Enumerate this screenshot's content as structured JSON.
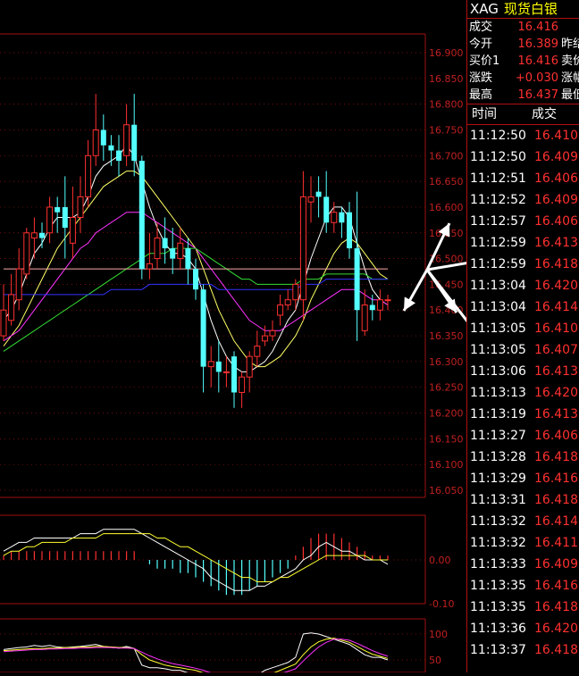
{
  "header": {
    "symbol": "XAG",
    "name": "现货白银"
  },
  "quote": [
    {
      "label": "成交",
      "value": "16.416",
      "label2": ""
    },
    {
      "label": "今开",
      "value": "16.389",
      "label2": "昨结"
    },
    {
      "label": "买价1",
      "value": "16.416",
      "label2": "卖价"
    },
    {
      "label": "涨跌",
      "value": "+0.030",
      "label2": "涨幅"
    },
    {
      "label": "最高",
      "value": "16.437",
      "label2": "最低"
    }
  ],
  "ticks_header": {
    "time": "时间",
    "price": "成交"
  },
  "ticks": [
    {
      "time": "11:12:50",
      "price": "16.410"
    },
    {
      "time": "11:12:50",
      "price": "16.409"
    },
    {
      "time": "11:12:51",
      "price": "16.406"
    },
    {
      "time": "11:12:52",
      "price": "16.409"
    },
    {
      "time": "11:12:57",
      "price": "16.406"
    },
    {
      "time": "11:12:59",
      "price": "16.413"
    },
    {
      "time": "11:12:59",
      "price": "16.418"
    },
    {
      "time": "11:13:04",
      "price": "16.420"
    },
    {
      "time": "11:13:04",
      "price": "16.414"
    },
    {
      "time": "11:13:05",
      "price": "16.410"
    },
    {
      "time": "11:13:05",
      "price": "16.407"
    },
    {
      "time": "11:13:06",
      "price": "16.413"
    },
    {
      "time": "11:13:13",
      "price": "16.420"
    },
    {
      "time": "11:13:19",
      "price": "16.413"
    },
    {
      "time": "11:13:27",
      "price": "16.406"
    },
    {
      "time": "11:13:28",
      "price": "16.418"
    },
    {
      "time": "11:13:29",
      "price": "16.416"
    },
    {
      "time": "11:13:31",
      "price": "16.418"
    },
    {
      "time": "11:13:32",
      "price": "16.414"
    },
    {
      "time": "11:13:32",
      "price": "16.411"
    },
    {
      "time": "11:13:33",
      "price": "16.409"
    },
    {
      "time": "11:13:35",
      "price": "16.416"
    },
    {
      "time": "11:13:35",
      "price": "16.418"
    },
    {
      "time": "11:13:36",
      "price": "16.420"
    },
    {
      "time": "11:13:37",
      "price": "16.418"
    }
  ],
  "colors": {
    "up": "#ff3030",
    "down": "#54ffff",
    "grid": "#a01010",
    "label": "#c02020"
  },
  "chart_data": [
    {
      "type": "candlestick",
      "y_ticks": [
        "16.900",
        "16.850",
        "16.800",
        "16.750",
        "16.700",
        "16.650",
        "16.600",
        "16.550",
        "16.500",
        "16.450",
        "16.400",
        "16.350",
        "16.300",
        "16.250",
        "16.200",
        "16.150",
        "16.100",
        "16.050"
      ],
      "ylim": [
        16.05,
        16.92
      ],
      "candles": [
        {
          "o": 16.35,
          "c": 16.4,
          "h": 16.45,
          "l": 16.34
        },
        {
          "o": 16.38,
          "c": 16.43,
          "h": 16.47,
          "l": 16.37
        },
        {
          "o": 16.42,
          "c": 16.48,
          "h": 16.52,
          "l": 16.4
        },
        {
          "o": 16.47,
          "c": 16.55,
          "h": 16.56,
          "l": 16.46
        },
        {
          "o": 16.54,
          "c": 16.55,
          "h": 16.58,
          "l": 16.5
        },
        {
          "o": 16.55,
          "c": 16.54,
          "h": 16.57,
          "l": 16.52
        },
        {
          "o": 16.55,
          "c": 16.6,
          "h": 16.62,
          "l": 16.53
        },
        {
          "o": 16.6,
          "c": 16.59,
          "h": 16.62,
          "l": 16.55
        },
        {
          "o": 16.6,
          "c": 16.56,
          "h": 16.66,
          "l": 16.5
        },
        {
          "o": 16.53,
          "c": 16.58,
          "h": 16.64,
          "l": 16.5
        },
        {
          "o": 16.58,
          "c": 16.62,
          "h": 16.66,
          "l": 16.55
        },
        {
          "o": 16.62,
          "c": 16.7,
          "h": 16.73,
          "l": 16.6
        },
        {
          "o": 16.7,
          "c": 16.75,
          "h": 16.82,
          "l": 16.68
        },
        {
          "o": 16.75,
          "c": 16.72,
          "h": 16.78,
          "l": 16.69
        },
        {
          "o": 16.72,
          "c": 16.71,
          "h": 16.74,
          "l": 16.68
        },
        {
          "o": 16.71,
          "c": 16.69,
          "h": 16.74,
          "l": 16.66
        },
        {
          "o": 16.7,
          "c": 16.76,
          "h": 16.8,
          "l": 16.68
        },
        {
          "o": 16.76,
          "c": 16.69,
          "h": 16.82,
          "l": 16.66
        },
        {
          "o": 16.69,
          "c": 16.48,
          "h": 16.7,
          "l": 16.46
        },
        {
          "o": 16.48,
          "c": 16.49,
          "h": 16.55,
          "l": 16.46
        },
        {
          "o": 16.5,
          "c": 16.54,
          "h": 16.57,
          "l": 16.48
        },
        {
          "o": 16.54,
          "c": 16.52,
          "h": 16.58,
          "l": 16.49
        },
        {
          "o": 16.52,
          "c": 16.5,
          "h": 16.56,
          "l": 16.47
        },
        {
          "o": 16.5,
          "c": 16.53,
          "h": 16.56,
          "l": 16.48
        },
        {
          "o": 16.52,
          "c": 16.48,
          "h": 16.54,
          "l": 16.45
        },
        {
          "o": 16.48,
          "c": 16.44,
          "h": 16.5,
          "l": 16.42
        },
        {
          "o": 16.44,
          "c": 16.29,
          "h": 16.45,
          "l": 16.24
        },
        {
          "o": 16.29,
          "c": 16.3,
          "h": 16.33,
          "l": 16.25
        },
        {
          "o": 16.3,
          "c": 16.28,
          "h": 16.34,
          "l": 16.24
        },
        {
          "o": 16.28,
          "c": 16.28,
          "h": 16.31,
          "l": 16.25
        },
        {
          "o": 16.31,
          "c": 16.24,
          "h": 16.32,
          "l": 16.21
        },
        {
          "o": 16.24,
          "c": 16.27,
          "h": 16.28,
          "l": 16.21
        },
        {
          "o": 16.27,
          "c": 16.31,
          "h": 16.32,
          "l": 16.24
        },
        {
          "o": 16.31,
          "c": 16.33,
          "h": 16.36,
          "l": 16.29
        },
        {
          "o": 16.34,
          "c": 16.35,
          "h": 16.37,
          "l": 16.33
        },
        {
          "o": 16.35,
          "c": 16.36,
          "h": 16.38,
          "l": 16.34
        },
        {
          "o": 16.39,
          "c": 16.41,
          "h": 16.43,
          "l": 16.37
        },
        {
          "o": 16.41,
          "c": 16.42,
          "h": 16.44,
          "l": 16.4
        },
        {
          "o": 16.42,
          "c": 16.45,
          "h": 16.46,
          "l": 16.4
        },
        {
          "o": 16.42,
          "c": 16.62,
          "h": 16.67,
          "l": 16.38
        },
        {
          "o": 16.61,
          "c": 16.62,
          "h": 16.66,
          "l": 16.57
        },
        {
          "o": 16.63,
          "c": 16.62,
          "h": 16.66,
          "l": 16.58
        },
        {
          "o": 16.62,
          "c": 16.57,
          "h": 16.67,
          "l": 16.55
        },
        {
          "o": 16.57,
          "c": 16.59,
          "h": 16.61,
          "l": 16.55
        },
        {
          "o": 16.59,
          "c": 16.57,
          "h": 16.6,
          "l": 16.54
        },
        {
          "o": 16.59,
          "c": 16.52,
          "h": 16.61,
          "l": 16.5
        },
        {
          "o": 16.52,
          "c": 16.4,
          "h": 16.63,
          "l": 16.34
        },
        {
          "o": 16.36,
          "c": 16.41,
          "h": 16.44,
          "l": 16.35
        },
        {
          "o": 16.41,
          "c": 16.4,
          "h": 16.43,
          "l": 16.38
        },
        {
          "o": 16.4,
          "c": 16.42,
          "h": 16.44,
          "l": 16.38
        },
        {
          "o": 16.42,
          "c": 16.42,
          "h": 16.43,
          "l": 16.4
        }
      ],
      "ma": [
        {
          "color": "#ffffff",
          "values": [
            16.38,
            16.4,
            16.43,
            16.47,
            16.51,
            16.53,
            16.56,
            16.58,
            16.58,
            16.58,
            16.59,
            16.62,
            16.66,
            16.68,
            16.69,
            16.7,
            16.72,
            16.7,
            16.65,
            16.6,
            16.56,
            16.53,
            16.51,
            16.51,
            16.5,
            16.48,
            16.43,
            16.38,
            16.34,
            16.31,
            16.29,
            16.28,
            16.28,
            16.29,
            16.3,
            16.32,
            16.35,
            16.38,
            16.4,
            16.45,
            16.5,
            16.54,
            16.58,
            16.6,
            16.6,
            16.58,
            16.53,
            16.48,
            16.44,
            16.42,
            16.41
          ]
        },
        {
          "color": "#ffff66",
          "values": [
            16.33,
            16.35,
            16.37,
            16.4,
            16.43,
            16.46,
            16.49,
            16.52,
            16.54,
            16.56,
            16.58,
            16.6,
            16.62,
            16.64,
            16.65,
            16.66,
            16.67,
            16.67,
            16.66,
            16.64,
            16.62,
            16.6,
            16.58,
            16.56,
            16.54,
            16.52,
            16.48,
            16.44,
            16.4,
            16.37,
            16.34,
            16.32,
            16.3,
            16.29,
            16.29,
            16.3,
            16.31,
            16.33,
            16.35,
            16.38,
            16.42,
            16.45,
            16.48,
            16.51,
            16.53,
            16.54,
            16.53,
            16.51,
            16.49,
            16.47,
            16.46
          ]
        },
        {
          "color": "#ff33ff",
          "values": [
            16.34,
            16.35,
            16.36,
            16.38,
            16.4,
            16.42,
            16.44,
            16.46,
            16.48,
            16.5,
            16.52,
            16.53,
            16.55,
            16.56,
            16.57,
            16.58,
            16.59,
            16.59,
            16.59,
            16.58,
            16.57,
            16.56,
            16.55,
            16.54,
            16.53,
            16.52,
            16.5,
            16.48,
            16.46,
            16.44,
            16.42,
            16.4,
            16.38,
            16.37,
            16.36,
            16.36,
            16.36,
            16.37,
            16.38,
            16.39,
            16.4,
            16.41,
            16.42,
            16.43,
            16.44,
            16.44,
            16.44,
            16.43,
            16.42,
            16.42,
            16.41
          ]
        },
        {
          "color": "#33dd33",
          "values": [
            16.32,
            16.33,
            16.34,
            16.35,
            16.36,
            16.37,
            16.38,
            16.39,
            16.4,
            16.41,
            16.42,
            16.43,
            16.44,
            16.45,
            16.46,
            16.47,
            16.48,
            16.49,
            16.5,
            16.51,
            16.51,
            16.51,
            16.52,
            16.52,
            16.52,
            16.52,
            16.51,
            16.5,
            16.49,
            16.48,
            16.47,
            16.46,
            16.46,
            16.45,
            16.45,
            16.45,
            16.45,
            16.45,
            16.45,
            16.46,
            16.46,
            16.46,
            16.47,
            16.47,
            16.47,
            16.47,
            16.47,
            16.47,
            16.46,
            16.46,
            16.46
          ]
        },
        {
          "color": "#3333ff",
          "values": [
            16.43,
            16.43,
            16.43,
            16.43,
            16.43,
            16.43,
            16.43,
            16.43,
            16.43,
            16.43,
            16.43,
            16.43,
            16.43,
            16.43,
            16.44,
            16.44,
            16.44,
            16.44,
            16.44,
            16.45,
            16.45,
            16.45,
            16.45,
            16.45,
            16.45,
            16.45,
            16.45,
            16.45,
            16.44,
            16.44,
            16.44,
            16.44,
            16.44,
            16.44,
            16.44,
            16.44,
            16.44,
            16.44,
            16.44,
            16.45,
            16.45,
            16.45,
            16.46,
            16.46,
            16.46,
            16.46,
            16.46,
            16.46,
            16.46,
            16.46,
            16.46
          ]
        },
        {
          "color": "#ffaaaa",
          "values": [
            16.48,
            16.48,
            16.48,
            16.48,
            16.48,
            16.48,
            16.48,
            16.48,
            16.48,
            16.48,
            16.48,
            16.48,
            16.48,
            16.48,
            16.48,
            16.48,
            16.48,
            16.48,
            16.48,
            16.48,
            16.48,
            16.48,
            16.48,
            16.48,
            16.48,
            16.48,
            16.48,
            16.48,
            16.48,
            16.48,
            16.48,
            16.48,
            16.48,
            16.48,
            16.48,
            16.48,
            16.48,
            16.48,
            16.48,
            16.48,
            16.48,
            16.48,
            16.48,
            16.48,
            16.48,
            16.48,
            16.48,
            16.48,
            16.48,
            16.48,
            16.48
          ]
        }
      ]
    },
    {
      "type": "macd",
      "y_ticks": [
        "0.00",
        "-0.10"
      ],
      "ylim": [
        -0.13,
        0.13
      ],
      "histogram": [
        0.01,
        0.02,
        0.02,
        0.02,
        0.02,
        0.02,
        0.02,
        0.02,
        0.02,
        0.02,
        0.02,
        0.02,
        0.02,
        0.02,
        0.02,
        0.02,
        0.02,
        0.02,
        0.0,
        -0.01,
        -0.02,
        -0.02,
        -0.02,
        -0.03,
        -0.03,
        -0.04,
        -0.05,
        -0.06,
        -0.07,
        -0.08,
        -0.08,
        -0.08,
        -0.07,
        -0.06,
        -0.05,
        -0.04,
        -0.03,
        -0.02,
        0.01,
        0.03,
        0.05,
        0.06,
        0.06,
        0.06,
        0.05,
        0.04,
        0.03,
        0.02,
        0.01,
        0.01,
        0.01
      ],
      "dif": [
        0.02,
        0.03,
        0.04,
        0.04,
        0.05,
        0.05,
        0.05,
        0.05,
        0.05,
        0.05,
        0.06,
        0.06,
        0.06,
        0.07,
        0.07,
        0.07,
        0.07,
        0.07,
        0.06,
        0.05,
        0.04,
        0.03,
        0.02,
        0.01,
        0.0,
        -0.01,
        -0.02,
        -0.04,
        -0.05,
        -0.06,
        -0.07,
        -0.07,
        -0.07,
        -0.06,
        -0.06,
        -0.05,
        -0.04,
        -0.03,
        -0.02,
        0.0,
        0.01,
        0.03,
        0.04,
        0.03,
        0.02,
        0.02,
        0.01,
        0.0,
        0.0,
        0.0,
        -0.01
      ],
      "dea": [
        0.01,
        0.02,
        0.02,
        0.03,
        0.03,
        0.04,
        0.04,
        0.04,
        0.04,
        0.05,
        0.05,
        0.05,
        0.05,
        0.06,
        0.06,
        0.06,
        0.06,
        0.06,
        0.06,
        0.06,
        0.05,
        0.05,
        0.04,
        0.03,
        0.03,
        0.02,
        0.01,
        0.0,
        -0.01,
        -0.02,
        -0.03,
        -0.04,
        -0.04,
        -0.05,
        -0.05,
        -0.05,
        -0.04,
        -0.04,
        -0.03,
        -0.02,
        -0.01,
        0.0,
        0.01,
        0.01,
        0.01,
        0.01,
        0.01,
        0.01,
        0.0,
        0.0,
        0.0
      ]
    },
    {
      "type": "line",
      "y_ticks": [
        "100",
        "50"
      ],
      "ylim": [
        0,
        115
      ],
      "series": [
        {
          "color": "#ffffff",
          "values": [
            70,
            72,
            74,
            75,
            78,
            76,
            78,
            75,
            74,
            75,
            76,
            78,
            80,
            76,
            74,
            73,
            76,
            72,
            40,
            35,
            35,
            33,
            30,
            30,
            25,
            20,
            15,
            10,
            10,
            8,
            5,
            5,
            10,
            20,
            30,
            35,
            40,
            45,
            55,
            100,
            102,
            100,
            95,
            90,
            85,
            80,
            70,
            60,
            55,
            55,
            50
          ]
        },
        {
          "color": "#ffff33",
          "values": [
            68,
            69,
            70,
            71,
            72,
            72,
            73,
            73,
            74,
            74,
            75,
            75,
            76,
            76,
            75,
            74,
            74,
            72,
            60,
            50,
            45,
            40,
            37,
            35,
            32,
            30,
            25,
            20,
            17,
            14,
            10,
            8,
            9,
            12,
            18,
            24,
            30,
            36,
            42,
            60,
            75,
            85,
            90,
            92,
            88,
            84,
            76,
            68,
            61,
            57,
            53
          ]
        },
        {
          "color": "#ff33ff",
          "values": [
            66,
            67,
            68,
            69,
            70,
            70,
            71,
            71,
            72,
            72,
            73,
            73,
            74,
            74,
            74,
            73,
            73,
            72,
            65,
            58,
            52,
            47,
            43,
            40,
            37,
            34,
            30,
            25,
            22,
            18,
            15,
            12,
            11,
            12,
            15,
            19,
            23,
            28,
            33,
            48,
            62,
            75,
            84,
            90,
            90,
            88,
            82,
            75,
            68,
            62,
            57
          ]
        }
      ]
    }
  ]
}
